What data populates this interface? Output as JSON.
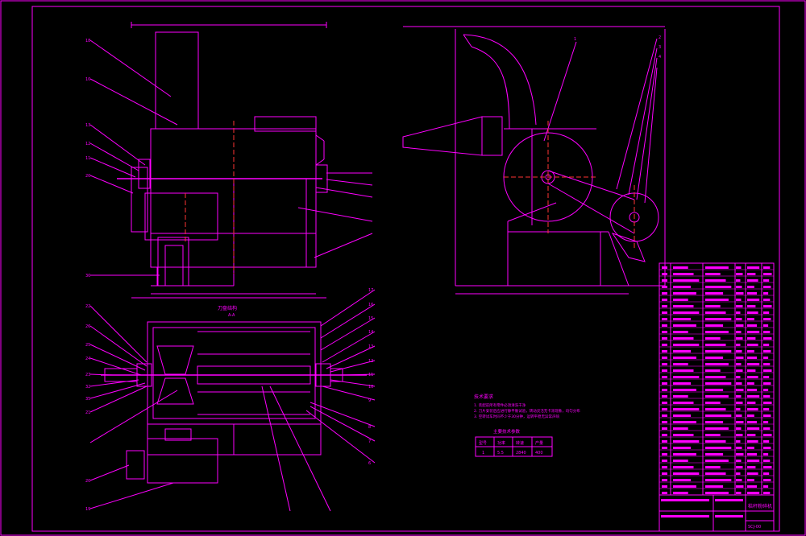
{
  "drawing": {
    "line_color": "#ff00ff",
    "center_color": "#ff3333",
    "background": "#000000",
    "front_view": {
      "balloons": [
        "18",
        "10",
        "13",
        "12",
        "11",
        "20",
        "30"
      ]
    },
    "section_view": {
      "title": "刀盘结构",
      "subtitle": "A-A",
      "balloons_left": [
        "22",
        "26",
        "25",
        "24",
        "23",
        "32",
        "35",
        "21",
        "20",
        "19"
      ],
      "balloons_right": [
        "17",
        "16",
        "15",
        "14",
        "13",
        "12",
        "11",
        "10",
        "9",
        "8",
        "7",
        "6"
      ]
    },
    "side_view": {
      "balloons": [
        "1",
        "2",
        "3",
        "4"
      ]
    },
    "notes": {
      "title": "技术要求",
      "lines": [
        "1. 装配前所有零件必须清洗干净",
        "2. 刀片安装后应进行静平衡试验，转动灵活无卡滞现象，均匀分布",
        "3. 空转试车时间不少于30分钟，运转平稳无异常声响"
      ]
    },
    "spec_table": {
      "title": "主要技术参数",
      "headers": [
        "型号",
        "功率",
        "转速",
        "产量"
      ],
      "values": [
        "1",
        "5.5",
        "2840",
        "400"
      ]
    },
    "title_block": {
      "drawing_name": "秸秆粉碎机",
      "drawing_code": "SCJ-00"
    }
  }
}
